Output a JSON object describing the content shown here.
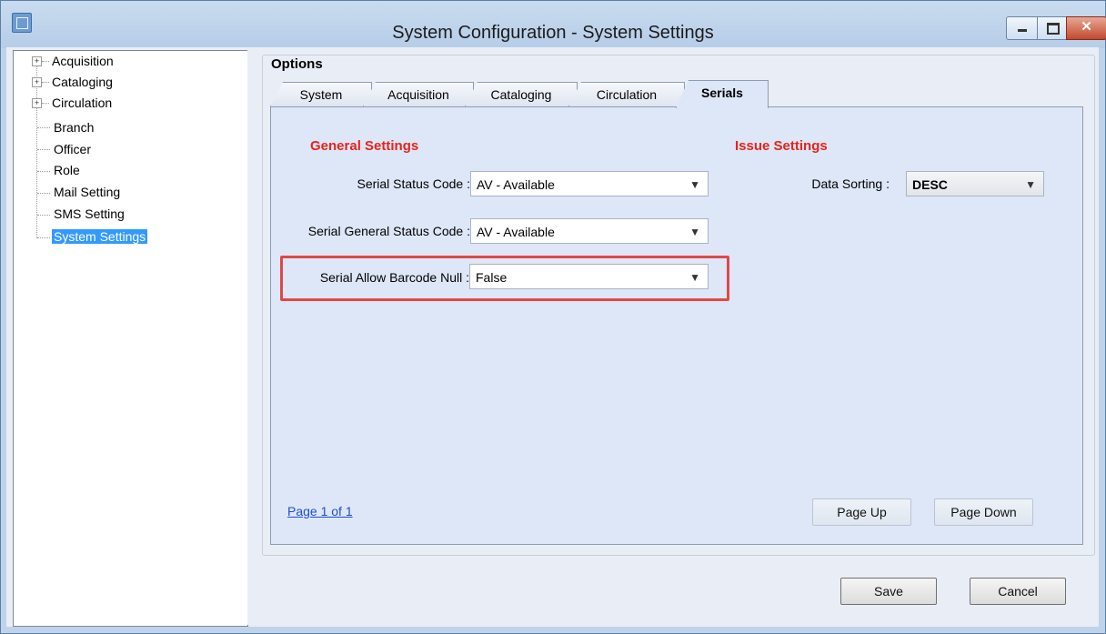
{
  "window": {
    "title": "System Configuration - System Settings"
  },
  "tree": {
    "items": [
      {
        "label": "Acquisition",
        "expandable": true
      },
      {
        "label": "Cataloging",
        "expandable": true
      },
      {
        "label": "Circulation",
        "expandable": true
      },
      {
        "label": "Branch",
        "expandable": false
      },
      {
        "label": "Officer",
        "expandable": false
      },
      {
        "label": "Role",
        "expandable": false
      },
      {
        "label": "Mail Setting",
        "expandable": false
      },
      {
        "label": "SMS Setting",
        "expandable": false
      },
      {
        "label": "System Settings",
        "expandable": false,
        "selected": true
      }
    ]
  },
  "options": {
    "title": "Options",
    "tabs": [
      {
        "label": "System"
      },
      {
        "label": "Acquisition"
      },
      {
        "label": "Cataloging"
      },
      {
        "label": "Circulation"
      },
      {
        "label": "Serials",
        "active": true
      }
    ]
  },
  "general": {
    "heading": "General Settings",
    "serial_status_label": "Serial Status Code :",
    "serial_status_value": "AV - Available",
    "serial_general_status_label": "Serial General Status Code :",
    "serial_general_status_value": "AV - Available",
    "serial_allow_barcode_null_label": "Serial Allow Barcode Null :",
    "serial_allow_barcode_null_value": "False"
  },
  "issue": {
    "heading": "Issue Settings",
    "data_sorting_label": "Data Sorting :",
    "data_sorting_value": "DESC"
  },
  "pager": {
    "page_text": "Page 1 of 1",
    "page_up": "Page Up",
    "page_down": "Page Down"
  },
  "footer": {
    "save": "Save",
    "cancel": "Cancel"
  },
  "colors": {
    "heading_red": "#e8231a",
    "highlight_red": "#e04848",
    "selection_blue": "#3399ff",
    "link_blue": "#1f4fd8"
  },
  "icons": {
    "app": "app-window-icon",
    "minimize": "minimize-icon",
    "maximize": "maximize-icon",
    "close": "close-icon",
    "dropdown": "chevron-down-icon",
    "expand": "plus-expander-icon"
  }
}
